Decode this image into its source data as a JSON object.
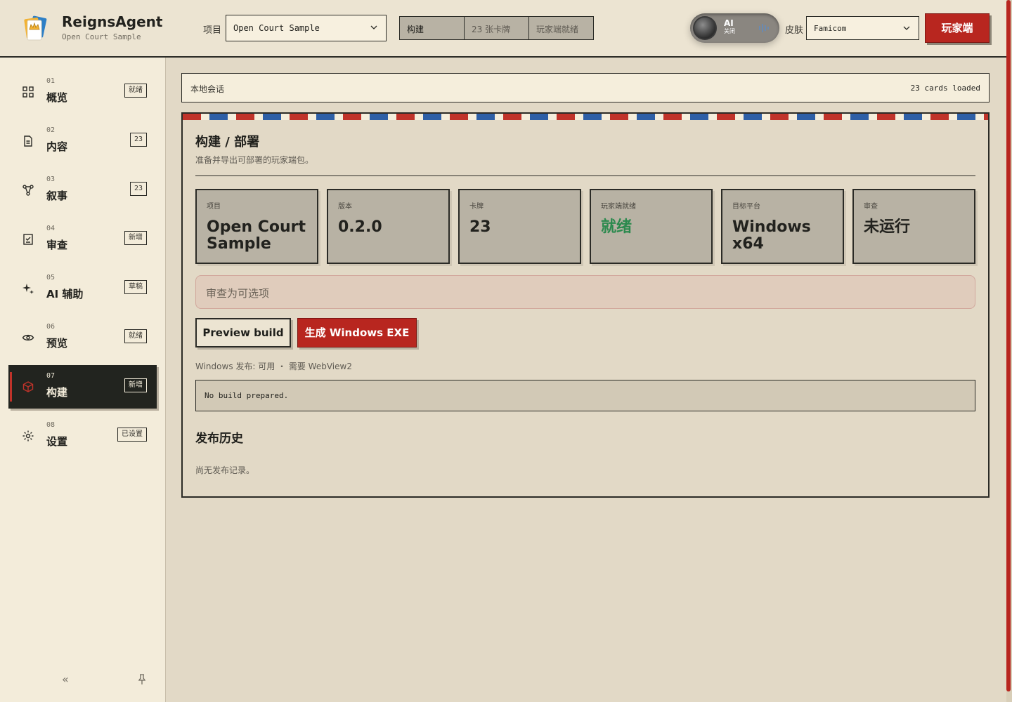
{
  "app": {
    "title": "ReignsAgent",
    "subtitle": "Open Court Sample"
  },
  "header": {
    "project_label": "项目",
    "project_value": "Open Court Sample",
    "status": {
      "build": "构建",
      "cards": "23 张卡牌",
      "player": "玩家端就绪"
    },
    "ai_toggle": {
      "label": "AI",
      "state": "关闭"
    },
    "skin_label": "皮肤",
    "skin_value": "Famicom",
    "player_button": "玩家端"
  },
  "sidebar": {
    "items": [
      {
        "num": "01",
        "label": "概览",
        "badge": "就绪"
      },
      {
        "num": "02",
        "label": "内容",
        "badge": "23"
      },
      {
        "num": "03",
        "label": "叙事",
        "badge": "23"
      },
      {
        "num": "04",
        "label": "审查",
        "badge": "新增"
      },
      {
        "num": "05",
        "label": "AI 辅助",
        "badge": "草稿"
      },
      {
        "num": "06",
        "label": "预览",
        "badge": "就绪"
      },
      {
        "num": "07",
        "label": "构建",
        "badge": "新增"
      },
      {
        "num": "08",
        "label": "设置",
        "badge": "已设置"
      }
    ],
    "active_index": 6,
    "collapse": "«"
  },
  "session": {
    "label": "本地会话",
    "status": "23 cards loaded"
  },
  "build": {
    "title": "构建 / 部署",
    "description": "准备并导出可部署的玩家端包。",
    "stats": [
      {
        "key": "项目",
        "value": "Open Court Sample"
      },
      {
        "key": "版本",
        "value": "0.2.0"
      },
      {
        "key": "卡牌",
        "value": "23"
      },
      {
        "key": "玩家端就绪",
        "value": "就绪"
      },
      {
        "key": "目标平台",
        "value": "Windows x64"
      },
      {
        "key": "审查",
        "value": "未运行"
      }
    ],
    "review_note": "审查为可选项",
    "preview_button": "Preview build",
    "exe_button": "生成 Windows EXE",
    "release_note": "Windows 发布: 可用 ・ 需要 WebView2",
    "output": "No build prepared.",
    "history_title": "发布历史",
    "history_empty": "尚无发布记录。"
  },
  "colors": {
    "accent_red": "#b8261f",
    "ready_green": "#2c8a4e",
    "stripe_blue": "#2e5fa6"
  }
}
